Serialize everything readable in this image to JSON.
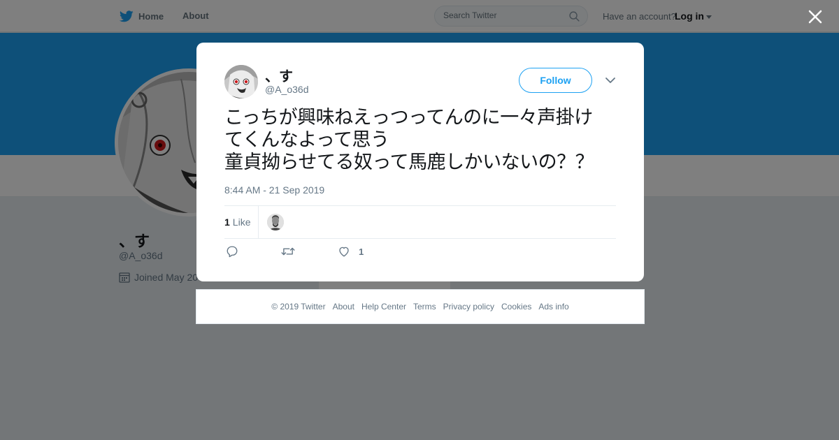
{
  "header": {
    "home_label": "Home",
    "about_label": "About",
    "search_placeholder": "Search Twitter",
    "have_account": "Have an account?",
    "login_label": "Log in"
  },
  "profile": {
    "name": "、す",
    "handle": "@A_o36d",
    "joined": "Joined May 20"
  },
  "tweet": {
    "author_name": "、す",
    "author_handle": "@A_o36d",
    "follow_label": "Follow",
    "text_lines": [
      "こっちが興味ねえっつってんのに一々声掛け",
      "てくんなよって思う",
      "童貞拗らせてる奴って馬鹿しかいないの？？"
    ],
    "timestamp": "8:44 AM - 21 Sep 2019",
    "likes_count": "1",
    "likes_label": "Like",
    "action_like_count": "1"
  },
  "footer": {
    "links": [
      "© 2019 Twitter",
      "About",
      "Help Center",
      "Terms",
      "Privacy policy",
      "Cookies",
      "Ads info"
    ]
  },
  "colors": {
    "brand_blue": "#1da1f2",
    "overlay": "rgba(0,0,0,0.5)",
    "secondary_text": "#657786"
  },
  "icons": [
    "twitter-bird-icon",
    "search-icon",
    "close-icon",
    "chevron-down-icon",
    "calendar-icon",
    "reply-icon",
    "retweet-icon",
    "heart-icon"
  ]
}
